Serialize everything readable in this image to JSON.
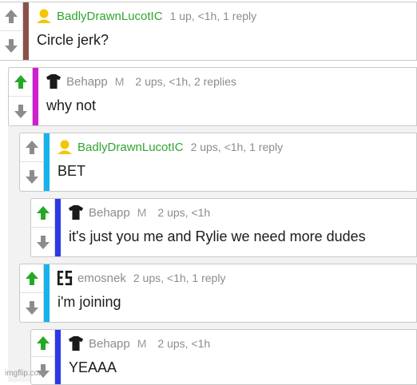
{
  "comments": [
    {
      "username": "BadlyDrawnLucotIC",
      "badge": "",
      "meta": "1 up, <1h, 1 reply",
      "text": "Circle jerk?",
      "upvoted": false,
      "user_color": "#2fa52f",
      "bar_color": "#8b5148",
      "avatar_icon": "yellow-user-icon"
    },
    {
      "username": "Behapp",
      "badge": "M",
      "meta": "2 ups, <1h, 2 replies",
      "text": "why not",
      "upvoted": true,
      "user_color": "#8c8c8c",
      "bar_color": "#cf1dcf",
      "avatar_icon": "black-shirt-icon"
    },
    {
      "username": "BadlyDrawnLucotIC",
      "badge": "",
      "meta": "2 ups, <1h, 1 reply",
      "text": "BET",
      "upvoted": false,
      "user_color": "#2fa52f",
      "bar_color": "#15b2ec",
      "avatar_icon": "yellow-user-icon"
    },
    {
      "username": "Behapp",
      "badge": "M",
      "meta": "2 ups, <1h",
      "text": "it's just you me and Rylie we need more dudes",
      "upvoted": true,
      "user_color": "#8c8c8c",
      "bar_color": "#2b3ae6",
      "avatar_icon": "black-shirt-icon"
    },
    {
      "username": "emosnek",
      "badge": "",
      "meta": "2 ups, <1h, 1 reply",
      "text": "i'm joining",
      "upvoted": true,
      "user_color": "#8c8c8c",
      "bar_color": "#15b2ec",
      "avatar_icon": "black-pixel-avatar-icon"
    },
    {
      "username": "Behapp",
      "badge": "M",
      "meta": "2 ups, <1h",
      "text": "YEAAA",
      "upvoted": true,
      "user_color": "#8c8c8c",
      "bar_color": "#2b3ae6",
      "avatar_icon": "black-shirt-icon"
    }
  ],
  "watermark": "imgflip.com",
  "colors": {
    "vote_active": "#25a825",
    "vote_inactive": "#8c8c8c"
  }
}
